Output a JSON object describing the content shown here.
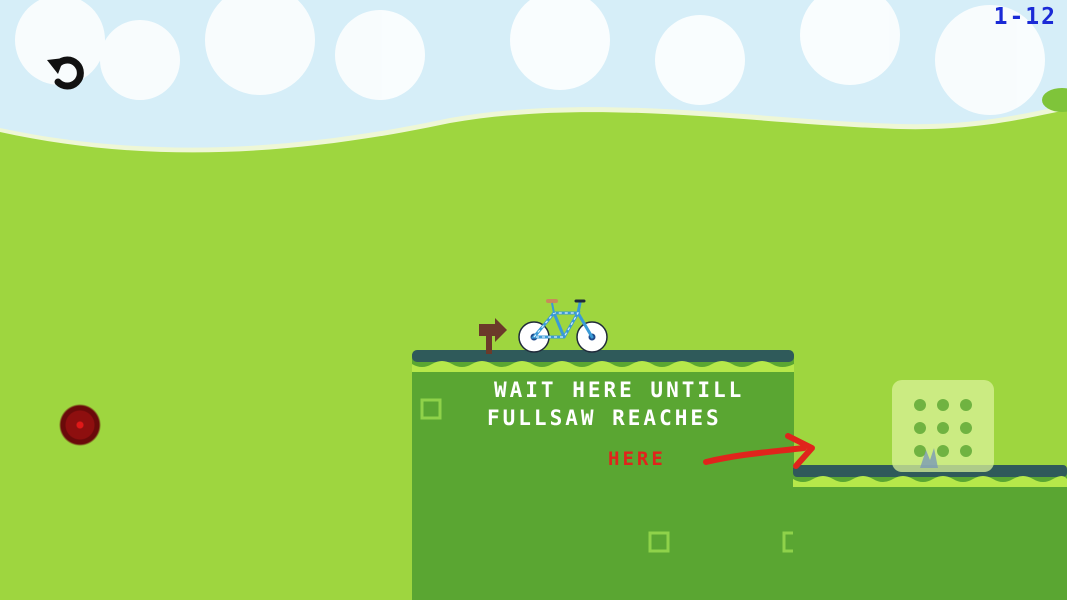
{
  "hud": {
    "level": "1-12",
    "restart_icon": "restart-arrow-icon",
    "joystick_icon": "joystick-knob-icon"
  },
  "hint": {
    "line1": "WAIT HERE UNTILL",
    "line2": "FULLSAW REACHES",
    "here": "HERE"
  },
  "colors": {
    "sky": "#d6eef8",
    "hill_back": "#a8e04a",
    "grass_front": "#9ed63f",
    "platform": "#5aa632",
    "platform_edge": "#2f5a5a",
    "level_text": "#1a2ad6",
    "hint_text": "#ffffff",
    "here_text": "#e0241c"
  }
}
